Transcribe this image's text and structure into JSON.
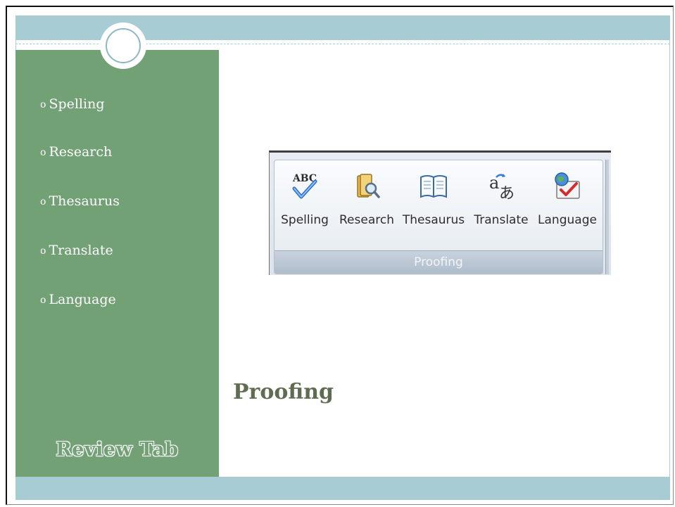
{
  "slide": {
    "title": "Proofing",
    "section_label": "Review Tab"
  },
  "sidebar": {
    "bullet_symbol": "o",
    "items": [
      {
        "label": "Spelling"
      },
      {
        "label": "Research"
      },
      {
        "label": "Thesaurus"
      },
      {
        "label": "Translate"
      },
      {
        "label": "Language"
      }
    ]
  },
  "ribbon": {
    "group_label": "Proofing",
    "buttons": [
      {
        "label": "Spelling",
        "icon": "spelling-abc-check-icon",
        "icon_text": "ABC"
      },
      {
        "label": "Research",
        "icon": "research-book-magnifier-icon"
      },
      {
        "label": "Thesaurus",
        "icon": "thesaurus-book-icon"
      },
      {
        "label": "Translate",
        "icon": "translate-icon",
        "icon_text_a": "a",
        "icon_text_b": "あ"
      },
      {
        "label": "Language",
        "icon": "language-globe-check-icon"
      }
    ]
  },
  "colors": {
    "sidebar": "#72a176",
    "band": "#a7ccd4",
    "title": "#5f6c52"
  }
}
